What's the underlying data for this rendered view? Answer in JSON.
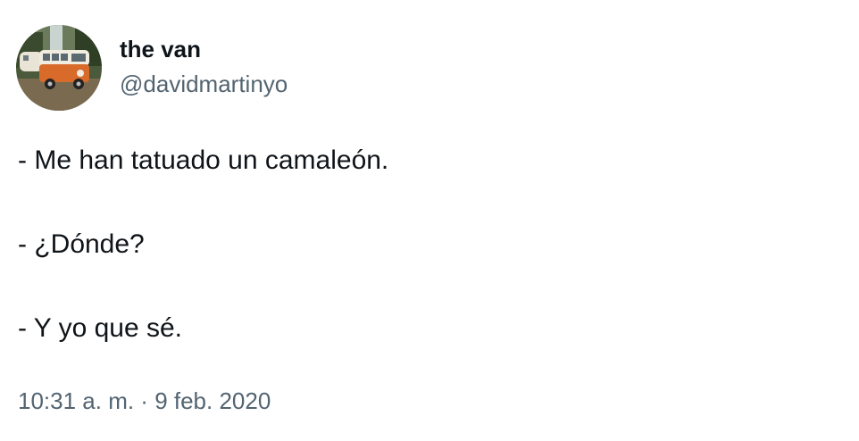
{
  "author": {
    "display_name": "the van",
    "handle": "@davidmartinyo"
  },
  "tweet": {
    "lines": [
      "- Me han tatuado un camaleón.",
      "- ¿Dónde?",
      "- Y yo que sé."
    ],
    "time": "10:31 a. m.",
    "separator": " · ",
    "date": "9 feb. 2020"
  },
  "colors": {
    "text": "#0f1419",
    "secondary": "#536471",
    "background": "#ffffff"
  }
}
